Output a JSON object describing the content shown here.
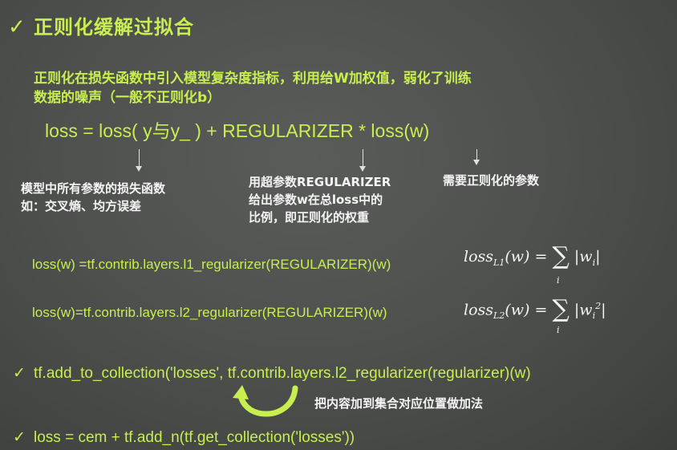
{
  "title": {
    "check": "✓",
    "text": "正则化缓解过拟合"
  },
  "intro": {
    "line1": "正则化在损失函数中引入模型复杂度指标，利用给W加权值，弱化了训练",
    "line2": "数据的噪声（一般不正则化b）"
  },
  "formula": "loss = loss( y与y_ ) + REGULARIZER * loss(w)",
  "notes": {
    "left": {
      "line1": "模型中所有参数的损失函数",
      "line2": "如：交叉熵、均方误差"
    },
    "middle": {
      "line1": "用超参数REGULARIZER",
      "line2": "给出参数w在总loss中的",
      "line3": "比例，即正则化的权重"
    },
    "right": "需要正则化的参数"
  },
  "l1": {
    "code": "loss(w) =tf.contrib.layers.l1_regularizer(REGULARIZER)(w)",
    "math_lhs": "loss",
    "math_sub": "L1",
    "math_arg": "(w) = ",
    "sigma": "∑",
    "sigma_sub": "i",
    "math_rhs": "|w",
    "math_rhs_sub": "i",
    "math_rhs_end": "|"
  },
  "l2": {
    "code": "loss(w)=tf.contrib.layers.l2_regularizer(REGULARIZER)(w)",
    "math_lhs": "loss",
    "math_sub": "L2",
    "math_arg": "(w) = ",
    "sigma": "∑",
    "sigma_sub": "i",
    "math_rhs": "|w",
    "math_rhs_sub": "i",
    "math_rhs_sup": "2",
    "math_rhs_end": "|"
  },
  "bullets": {
    "check": "✓",
    "add_collection": "tf.add_to_collection('losses', tf.contrib.layers.l2_regularizer(regularizer)(w)",
    "add_note": "把内容加到集合对应位置做加法",
    "total_loss": "loss = cem + tf.add_n(tf.get_collection('losses'))"
  },
  "colors": {
    "accent": "#c8ee50",
    "text": "#f4f4f4",
    "background": "#4f514f"
  }
}
